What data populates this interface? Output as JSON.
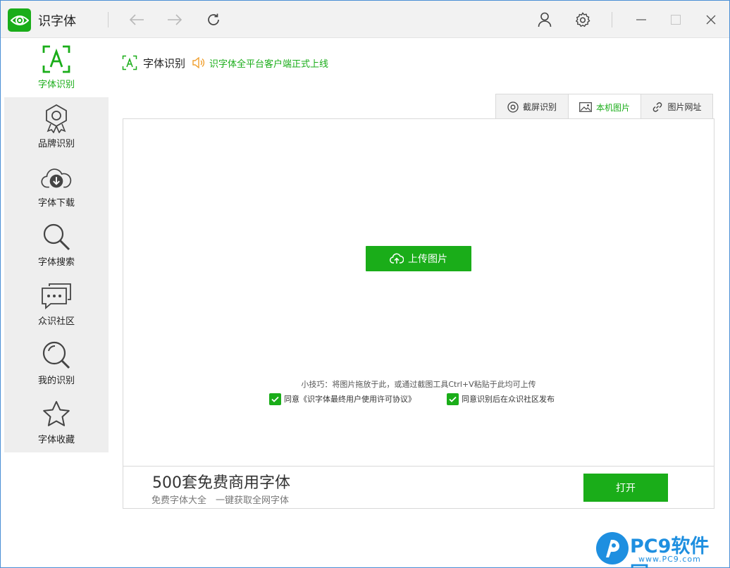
{
  "app": {
    "title": "识字体"
  },
  "sidebar": {
    "items": [
      {
        "label": "字体识别",
        "icon": "font-recognition-icon",
        "active": true
      },
      {
        "label": "品牌识别",
        "icon": "brand-badge-icon"
      },
      {
        "label": "字体下载",
        "icon": "cloud-download-icon"
      },
      {
        "label": "字体搜索",
        "icon": "search-icon"
      },
      {
        "label": "众识社区",
        "icon": "chat-bubbles-icon"
      },
      {
        "label": "我的识别",
        "icon": "my-search-icon"
      },
      {
        "label": "字体收藏",
        "icon": "star-icon"
      }
    ]
  },
  "header": {
    "title": "字体识别",
    "notice": "识字体全平台客户端正式上线"
  },
  "tabs": [
    {
      "label": "截屏识别",
      "icon": "screenshot-icon"
    },
    {
      "label": "本机图片",
      "icon": "image-icon",
      "active": true
    },
    {
      "label": "图片网址",
      "icon": "link-icon"
    }
  ],
  "upload": {
    "button_label": "上传图片",
    "tip": "小技巧：将图片拖放于此，或通过截图工具Ctrl+V粘贴于此均可上传",
    "agree_license": "同意《识字体最终用户使用许可协议》",
    "agree_publish": "同意识别后在众识社区发布"
  },
  "promo": {
    "title": "500套免费商用字体",
    "subtitle": "免费字体大全　一键获取全网字体",
    "button_label": "打开"
  },
  "watermark": {
    "text": "PC9软件园",
    "url": "www.PC9.com"
  },
  "colors": {
    "accent": "#1aad19",
    "notice_icon": "#f0a030",
    "watermark": "#1e8fe0"
  }
}
